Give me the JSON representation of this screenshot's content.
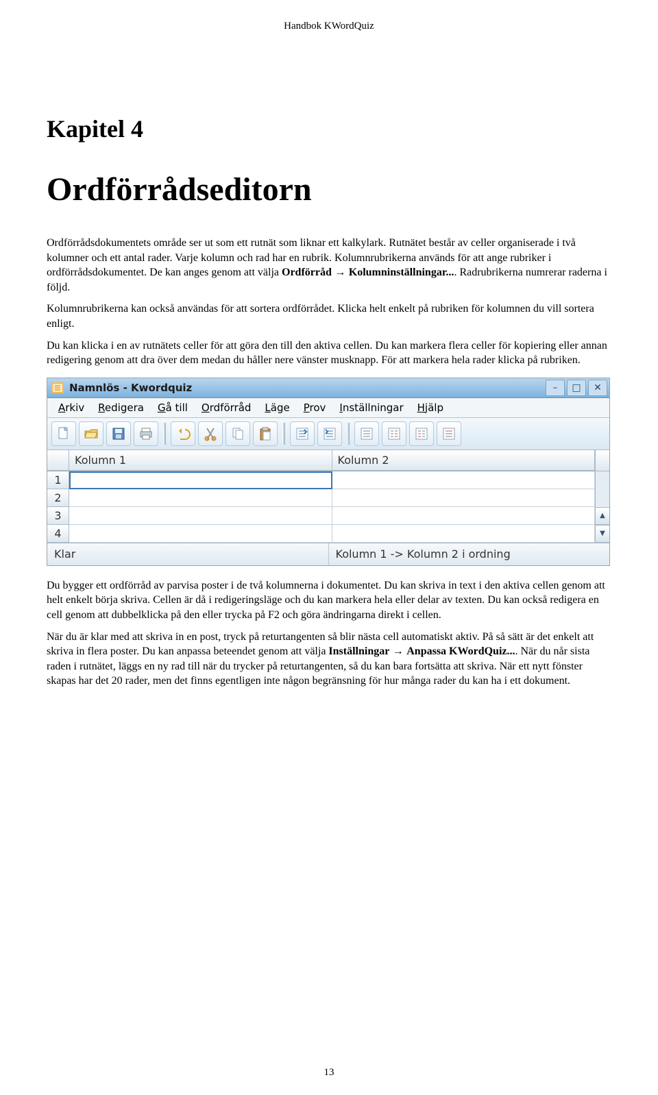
{
  "doc_header": "Handbok KWordQuiz",
  "chapter_label": "Kapitel 4",
  "chapter_title": "Ordförrådseditorn",
  "paragraphs": {
    "p1": "Ordförrådsdokumentets område ser ut som ett rutnät som liknar ett kalkylark. Rutnätet består av celler organiserade i två kolumner och ett antal rader. Varje kolumn och rad har en rubrik. Kolumnrubrikerna används för att ange rubriker i ordförrådsdokumentet. De kan anges genom att välja ",
    "p1_bold1": "Ordförråd",
    "p1_arrow": " → ",
    "p1_bold2": "Kolumninställningar...",
    "p1_tail": ". Radrubrikerna numrerar raderna i följd.",
    "p2": "Kolumnrubrikerna kan också användas för att sortera ordförrådet. Klicka helt enkelt på rubriken för kolumnen du vill sortera enligt.",
    "p3": "Du kan klicka i en av rutnätets celler för att göra den till den aktiva cellen. Du kan markera flera celler för kopiering eller annan redigering genom att dra över dem medan du håller nere vänster musknapp. För att markera hela rader klicka på rubriken.",
    "p4": "Du bygger ett ordförråd av parvisa poster i de två kolumnerna i dokumentet. Du kan skriva in text i den aktiva cellen genom att helt enkelt börja skriva. Cellen är då i redigeringsläge och du kan markera hela eller delar av texten. Du kan också redigera en cell genom att dubbelklicka på den eller trycka på F2 och göra ändringarna direkt i cellen.",
    "p5_a": "När du är klar med att skriva in en post, tryck på returtangenten så blir nästa cell automatiskt aktiv. På så sätt är det enkelt att skriva in flera poster. Du kan anpassa beteendet genom att välja ",
    "p5_bold1": "Inställningar",
    "p5_arrow": " → ",
    "p5_bold2": "Anpassa KWordQuiz...",
    "p5_b": ". När du når sista raden i rutnätet, läggs en ny rad till när du trycker på returtangenten, så du kan bara fortsätta att skriva. När ett nytt fönster skapas har det 20 rader, men det finns egentligen inte någon begränsning för hur många rader du kan ha i ett dokument."
  },
  "screenshot": {
    "title": "Namnlös - Kwordquiz",
    "menus": [
      {
        "label": "Arkiv",
        "ul": "A"
      },
      {
        "label": "Redigera",
        "ul": "R"
      },
      {
        "label": "Gå till",
        "ul": "G"
      },
      {
        "label": "Ordförråd",
        "ul": "O"
      },
      {
        "label": "Läge",
        "ul": "L"
      },
      {
        "label": "Prov",
        "ul": "P"
      },
      {
        "label": "Inställningar",
        "ul": "I"
      },
      {
        "label": "Hjälp",
        "ul": "H"
      }
    ],
    "columns": {
      "col1": "Kolumn 1",
      "col2": "Kolumn 2"
    },
    "rows": [
      "1",
      "2",
      "3",
      "4"
    ],
    "status_left": "Klar",
    "status_right": "Kolumn 1 -> Kolumn 2 i ordning"
  },
  "page_number": "13"
}
